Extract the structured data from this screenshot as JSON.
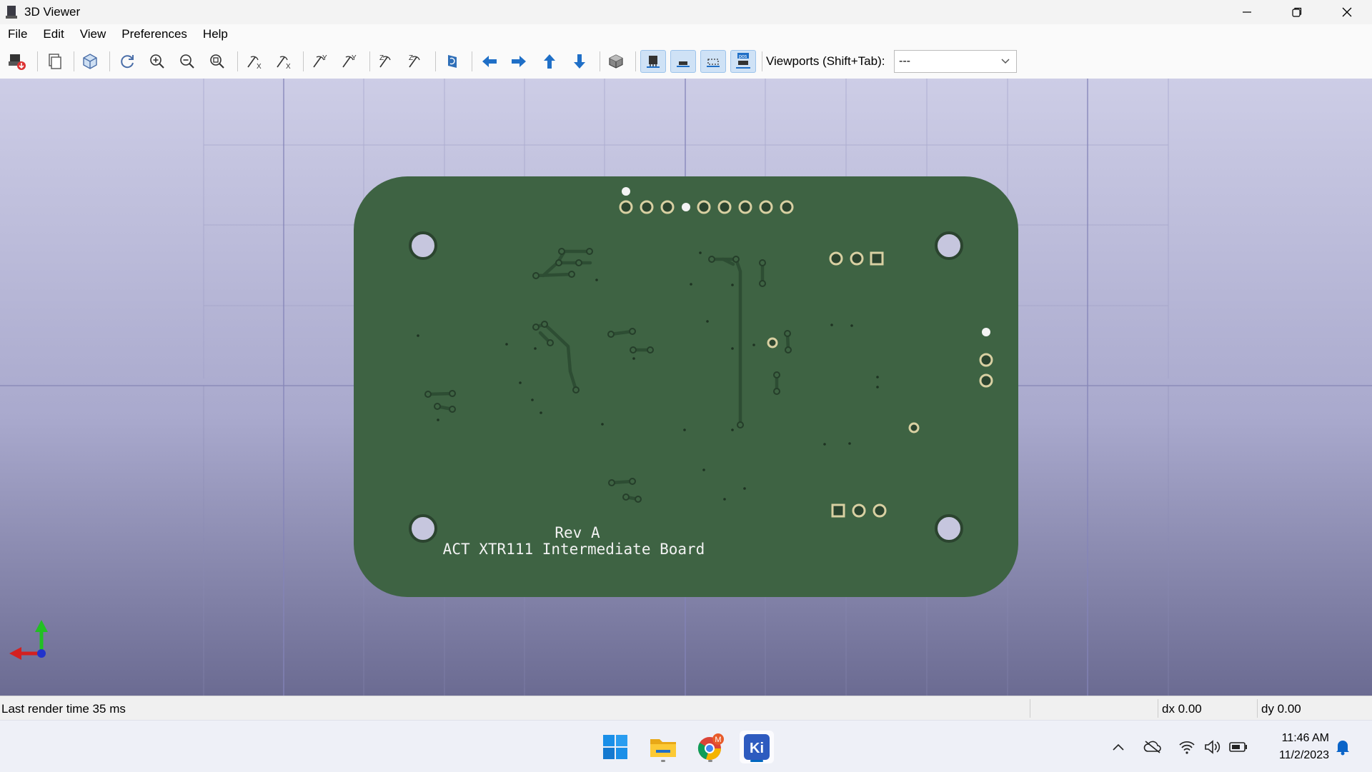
{
  "window": {
    "title": "3D Viewer"
  },
  "menu": [
    "File",
    "Edit",
    "View",
    "Preferences",
    "Help"
  ],
  "toolbar": {
    "viewports_label": "Viewports (Shift+Tab):",
    "viewports_value": "---"
  },
  "board": {
    "silk_line1": "Rev A",
    "silk_line2": "ACT XTR111 Intermediate Board",
    "color": "#3e6343"
  },
  "status": {
    "message": "Last render time 35 ms",
    "dx": "dx 0.00",
    "dy": "dy 0.00"
  },
  "taskbar": {
    "time": "11:46 AM",
    "date": "11/2/2023",
    "chrome_badge": "M",
    "kicad_label": "Ki"
  }
}
